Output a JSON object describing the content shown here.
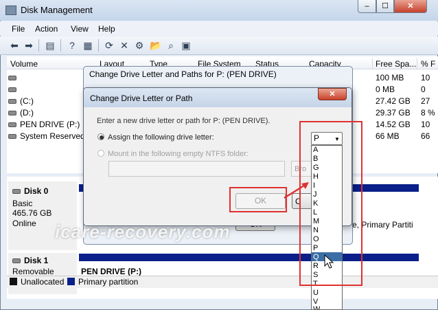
{
  "app": {
    "title": "Disk Management",
    "min": "–",
    "max": "☐",
    "close": "✕"
  },
  "menu": [
    "File",
    "Action",
    "View",
    "Help"
  ],
  "toolbar": {
    "icons": [
      "back-icon",
      "forward-icon",
      "console-tree-icon",
      "help-icon",
      "properties-icon",
      "refresh-icon",
      "delete-icon",
      "settings-icon",
      "open-icon",
      "search-icon",
      "view-icon"
    ]
  },
  "columns": [
    "Volume",
    "Layout",
    "Type",
    "File System",
    "Status",
    "Capacity",
    "Free Spa...",
    "% F"
  ],
  "volumes": [
    {
      "name": "",
      "free": "100 MB",
      "pct": "10"
    },
    {
      "name": "",
      "free": "0 MB",
      "pct": "0"
    },
    {
      "name": "(C:)",
      "free": "27.42 GB",
      "pct": "27"
    },
    {
      "name": "(D:)",
      "free": "29.37 GB",
      "pct": "8 %"
    },
    {
      "name": "PEN DRIVE (P:)",
      "free": "14.52 GB",
      "pct": "10"
    },
    {
      "name": "System Reserved",
      "free": "66 MB",
      "pct": "66"
    }
  ],
  "disk0": {
    "name": "Disk 0",
    "type": "Basic",
    "size": "465.76 GB",
    "status": "Online"
  },
  "disk1": {
    "name": "Disk 1",
    "type": "Removable"
  },
  "disk1_partition": "PEN DRIVE (P:)",
  "partition_partial": "e, Primary Partiti",
  "legend": {
    "unallocated": "Unallocated",
    "primary": "Primary partition"
  },
  "dialog_paths": {
    "title": "Change Drive Letter and Paths for P: (PEN DRIVE)",
    "ok": "OK"
  },
  "dialog_letter": {
    "title": "Change Drive Letter or Path",
    "close": "✕",
    "prompt": "Enter a new drive letter or path for P: (PEN DRIVE).",
    "assign_label": "Assign the following drive letter:",
    "mount_label": "Mount in the following empty NTFS folder:",
    "browse": "Bro",
    "ok": "OK",
    "cancel": "C",
    "selected_letter": "P",
    "letters": [
      "A",
      "B",
      "G",
      "H",
      "I",
      "J",
      "K",
      "L",
      "M",
      "N",
      "O",
      "P",
      "Q",
      "R",
      "S",
      "T",
      "U",
      "V",
      "W"
    ],
    "highlighted": "Q"
  },
  "watermark": "icare-recovery.com",
  "colors": {
    "partition": "#0a1f8a",
    "highlight": "#e03030"
  }
}
